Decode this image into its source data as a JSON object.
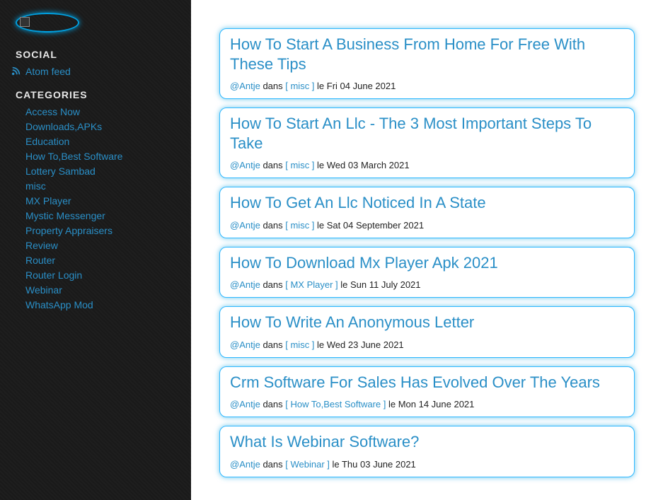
{
  "sidebar": {
    "social_heading": "SOCIAL",
    "feed_label": "Atom feed",
    "categories_heading": "CATEGORIES",
    "categories": [
      "Access Now",
      "Downloads,APKs",
      "Education",
      "How To,Best Software",
      "Lottery Sambad",
      "misc",
      "MX Player",
      "Mystic Messenger",
      "Property Appraisers",
      "Review",
      "Router",
      "Router Login",
      "Webinar",
      "WhatsApp Mod"
    ]
  },
  "meta_labels": {
    "author_prefix": "@",
    "author": "Antje",
    "dans": " dans ",
    "bracket_open": "[ ",
    "bracket_close": " ]",
    "le": " le "
  },
  "posts": [
    {
      "title": "How To Start A Business From Home For Free With These Tips",
      "category": "misc",
      "date": "Fri 04 June 2021"
    },
    {
      "title": "How To Start An Llc - The 3 Most Important Steps To Take",
      "category": "misc",
      "date": "Wed 03 March 2021"
    },
    {
      "title": "How To Get An Llc Noticed In A State",
      "category": "misc",
      "date": "Sat 04 September 2021"
    },
    {
      "title": "How To Download Mx Player Apk 2021",
      "category": "MX Player",
      "date": "Sun 11 July 2021"
    },
    {
      "title": "How To Write An Anonymous Letter",
      "category": "misc",
      "date": "Wed 23 June 2021"
    },
    {
      "title": "Crm Software For Sales Has Evolved Over The Years",
      "category": "How To,Best Software",
      "date": "Mon 14 June 2021"
    },
    {
      "title": "What Is Webinar Software?",
      "category": "Webinar",
      "date": "Thu 03 June 2021"
    }
  ]
}
